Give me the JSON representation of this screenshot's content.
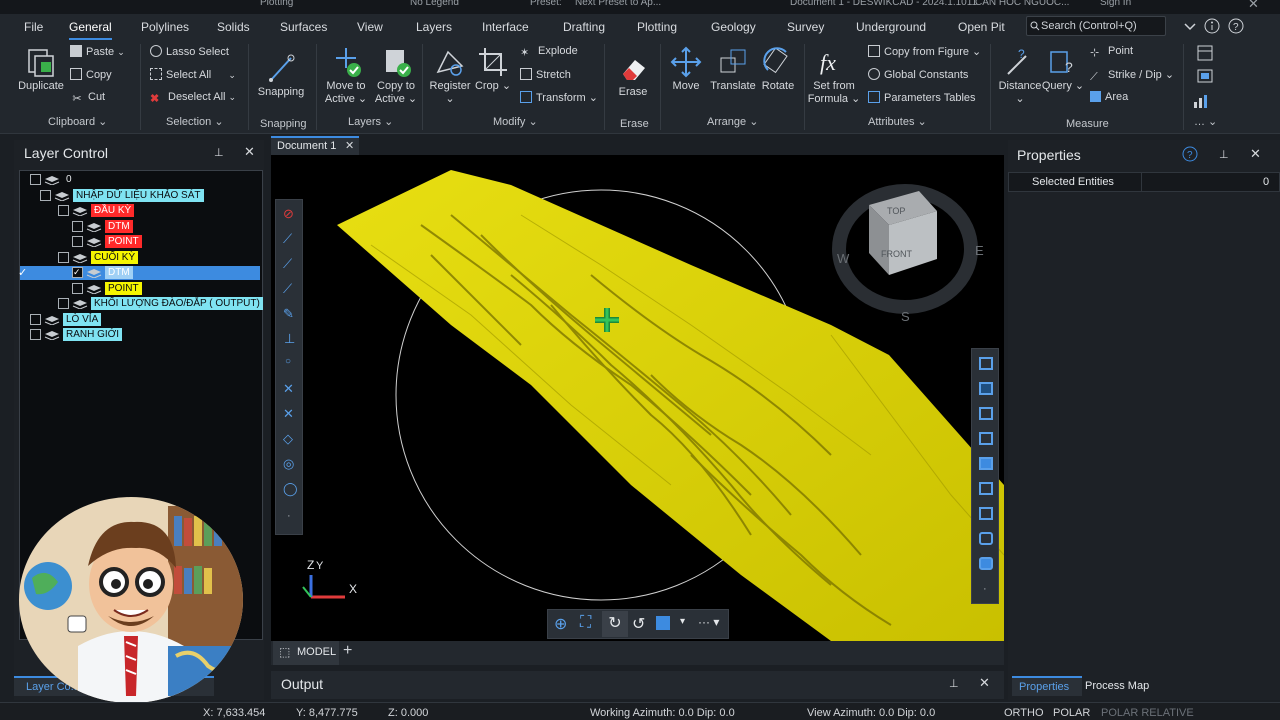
{
  "titlebar": {
    "left": "Plotting",
    "legend": "No Legend",
    "preset_label": "Preset:",
    "preset_value": "Next Preset to Ap...",
    "document": "Document 1 - DESWIKCAD - 2024.1.1011",
    "project": "CAN HOC NGUOC...",
    "signin": "Sign In"
  },
  "menu": [
    "File",
    "General",
    "Polylines",
    "Solids",
    "Surfaces",
    "View",
    "Layers",
    "Interface",
    "Drafting",
    "Plotting",
    "Geology",
    "Survey",
    "Underground",
    "Open Pit"
  ],
  "search_placeholder": "Search (Control+Q)",
  "ribbon": {
    "clipboard": {
      "duplicate": "Duplicate",
      "paste": "Paste",
      "copy": "Copy",
      "cut": "Cut",
      "label": "Clipboard"
    },
    "selection": {
      "lasso": "Lasso Select",
      "select_all": "Select All",
      "deselect_all": "Deselect All",
      "label": "Selection"
    },
    "snapping": {
      "snapping": "Snapping",
      "label": "Snapping"
    },
    "layers": {
      "move": "Move to",
      "move2": "Active",
      "copy": "Copy to",
      "copy2": "Active",
      "label": "Layers"
    },
    "modify": {
      "register": "Register",
      "crop": "Crop",
      "explode": "Explode",
      "stretch": "Stretch",
      "transform": "Transform",
      "label": "Modify"
    },
    "erase": {
      "erase": "Erase",
      "label": "Erase"
    },
    "arrange": {
      "move": "Move",
      "translate": "Translate",
      "rotate": "Rotate",
      "label": "Arrange"
    },
    "attributes": {
      "set_from": "Set from",
      "formula": "Formula",
      "copy_from_figure": "Copy from Figure",
      "global_constants": "Global Constants",
      "parameters_tables": "Parameters Tables",
      "label": "Attributes"
    },
    "measure": {
      "distance": "Distance",
      "query": "Query",
      "point": "Point",
      "strike_dip": "Strike / Dip",
      "area": "Area",
      "label": "Measure"
    }
  },
  "layer_control": {
    "title": "Layer Control",
    "rows": [
      {
        "name": "0",
        "bg": "none"
      },
      {
        "name": "NHẬP DỮ LIỆU KHẢO SÁT",
        "bg": "#7fe3f2"
      },
      {
        "name": "ĐẦU KỲ",
        "bg": "#ff2a2a"
      },
      {
        "name": "DTM",
        "bg": "#ff2a2a"
      },
      {
        "name": "POINT",
        "bg": "#ff2a2a"
      },
      {
        "name": "CUỐI KỲ",
        "bg": "#f5f500"
      },
      {
        "name": "DTM",
        "bg": "#f5f500"
      },
      {
        "name": "POINT",
        "bg": "#f5f500"
      },
      {
        "name": "KHỐI LƯỢNG ĐÀO/ĐẮP ( OUTPUT)",
        "bg": "#7fe3f2"
      },
      {
        "name": "LÒ VỈA",
        "bg": "#7fe3f2"
      },
      {
        "name": "RANH GIỚI",
        "bg": "#7fe3f2"
      }
    ],
    "footer_tab": "Layer Co..."
  },
  "document_tab": "Document 1",
  "viewcube": {
    "top": "TOP",
    "front": "FRONT",
    "w": "W",
    "e": "E",
    "s": "S"
  },
  "axes": {
    "z": "Z",
    "y": "Y",
    "x": "X"
  },
  "model_tab": "MODEL",
  "properties": {
    "title": "Properties",
    "selected_entities": "Selected Entities",
    "count": "0",
    "tab_properties": "Properties",
    "tab_process_map": "Process Map"
  },
  "output_title": "Output",
  "status": {
    "x": "X: 7,633.454",
    "y": "Y: 8,477.775",
    "z": "Z: 0.000",
    "working": "Working Azimuth: 0.0 Dip: 0.0",
    "view": "View Azimuth: 0.0 Dip: 0.0",
    "ortho": "ORTHO",
    "polar": "POLAR",
    "polar_rel": "POLAR RELATIVE"
  },
  "colors": {
    "accent": "#3d8be0",
    "surface": "#f2ea1c",
    "panel": "#1d2126"
  }
}
